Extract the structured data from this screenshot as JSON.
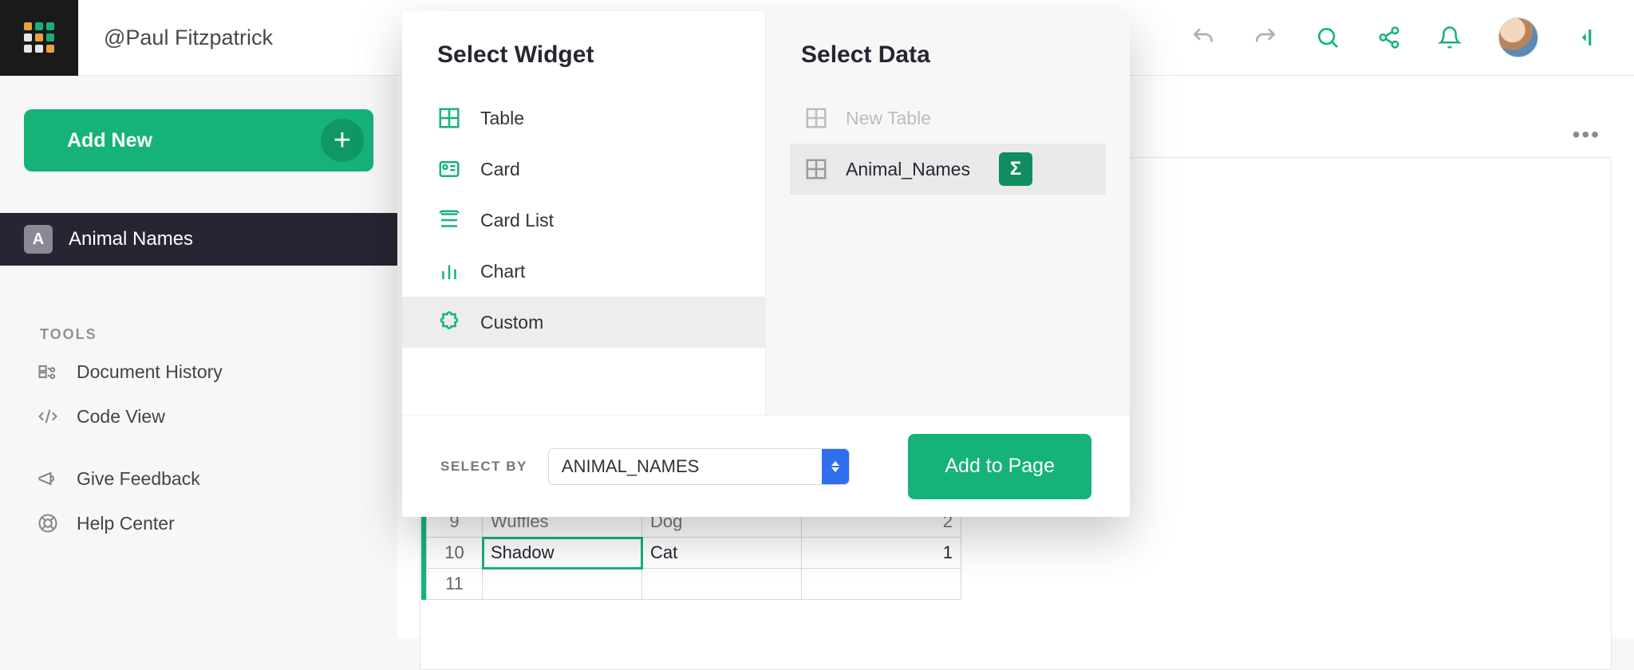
{
  "header": {
    "user_handle": "@Paul Fitzpatrick"
  },
  "sidebar": {
    "add_new_label": "Add New",
    "pages": [
      {
        "badge": "A",
        "label": "Animal Names",
        "active": true
      }
    ],
    "tools_heading": "TOOLS",
    "tools": [
      {
        "icon": "history-icon",
        "label": "Document History"
      },
      {
        "icon": "code-icon",
        "label": "Code View"
      }
    ],
    "tools_secondary": [
      {
        "icon": "megaphone-icon",
        "label": "Give Feedback"
      },
      {
        "icon": "lifebuoy-icon",
        "label": "Help Center"
      }
    ]
  },
  "modal": {
    "left_title": "Select Widget",
    "right_title": "Select Data",
    "widget_options": [
      {
        "icon": "table-icon",
        "label": "Table",
        "selected": false
      },
      {
        "icon": "card-icon",
        "label": "Card",
        "selected": false
      },
      {
        "icon": "cardlist-icon",
        "label": "Card List",
        "selected": false
      },
      {
        "icon": "chart-icon",
        "label": "Chart",
        "selected": false
      },
      {
        "icon": "puzzle-icon",
        "label": "Custom",
        "selected": true
      }
    ],
    "data_options": [
      {
        "label": "New Table",
        "disabled": true,
        "selected": false
      },
      {
        "label": "Animal_Names",
        "disabled": false,
        "selected": true,
        "sigma": true
      }
    ],
    "select_by_label": "SELECT BY",
    "select_by_value": "ANIMAL_NAMES",
    "add_button_label": "Add to Page"
  },
  "table_fragment": {
    "rows": [
      {
        "num": "9",
        "a": "Wuffles",
        "b": "Dog",
        "c": "2",
        "clipped": true
      },
      {
        "num": "10",
        "a": "Shadow",
        "b": "Cat",
        "c": "1",
        "selected_col": "a"
      },
      {
        "num": "11",
        "a": "",
        "b": "",
        "c": ""
      }
    ]
  }
}
